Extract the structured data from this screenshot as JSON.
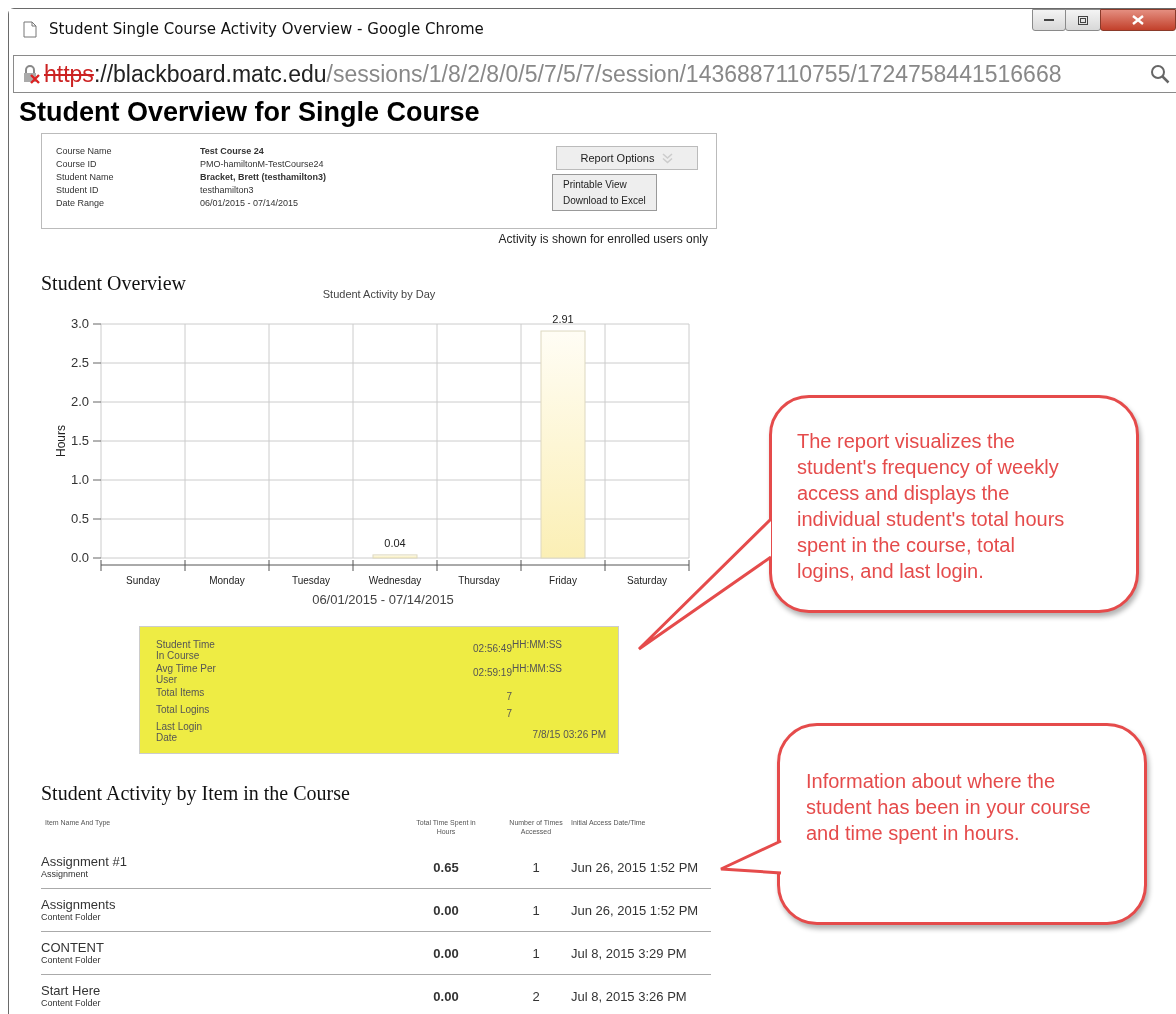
{
  "window": {
    "title": "Student Single Course Activity Overview - Google Chrome"
  },
  "address_bar": {
    "scheme": "https",
    "host": "://blackboard.matc.edu",
    "path": "/sessions/1/8/2/8/0/5/7/5/7/session/1436887110755/1724758441516668",
    "insecure": true
  },
  "page_title": "Student Overview for Single Course",
  "course_info": [
    {
      "label": "Course Name",
      "value": "Test Course 24",
      "bold": true
    },
    {
      "label": "Course ID",
      "value": "PMO-hamiltonM-TestCourse24",
      "bold": false
    },
    {
      "label": "Student Name",
      "value": "Bracket, Brett (testhamilton3)",
      "bold": true
    },
    {
      "label": "Student ID",
      "value": "testhamilton3",
      "bold": false
    },
    {
      "label": "Date Range",
      "value": "06/01/2015 - 07/14/2015",
      "bold": false
    }
  ],
  "report_options": {
    "label": "Report Options",
    "expanded": true,
    "items": [
      "Printable View",
      "Download to Excel"
    ]
  },
  "notice": "Activity is shown for enrolled users only",
  "overview_heading": "Student Overview",
  "chart_data": {
    "type": "bar",
    "title": "Student Activity by Day",
    "xlabel": "06/01/2015 - 07/14/2015",
    "ylabel": "Hours",
    "categories": [
      "Sunday",
      "Monday",
      "Tuesday",
      "Wednesday",
      "Thursday",
      "Friday",
      "Saturday"
    ],
    "values": [
      0,
      0,
      0,
      0.04,
      0,
      2.91,
      0
    ],
    "ylim": [
      0,
      3
    ],
    "yticks": [
      {
        "value": 0,
        "label": "0.0"
      },
      {
        "value": 0.5,
        "label": "0.5"
      },
      {
        "value": 1,
        "label": "1.0"
      },
      {
        "value": 1.5,
        "label": "1.5"
      },
      {
        "value": 2,
        "label": "2.0"
      },
      {
        "value": 2.5,
        "label": "2.5"
      },
      {
        "value": 3,
        "label": "3.0"
      }
    ],
    "grid": true,
    "value_labels": [
      null,
      null,
      null,
      "0.04",
      null,
      "2.91",
      null
    ]
  },
  "summary": [
    {
      "kind": "duration",
      "label": "Student Time In Course",
      "value": "02:56:49",
      "unit": "HH:MM:SS"
    },
    {
      "kind": "duration",
      "label": "Avg Time Per User",
      "value": "02:59:19",
      "unit": "HH:MM:SS"
    },
    {
      "kind": "count",
      "label": "Total Items",
      "value": "7"
    },
    {
      "kind": "count",
      "label": "Total Logins",
      "value": "7"
    },
    {
      "kind": "date",
      "label": "Last Login Date",
      "value": "7/8/15 03:26 PM"
    }
  ],
  "items_heading": "Student Activity by Item in the Course",
  "table": {
    "columns": [
      "Item Name And Type",
      "Total Time Spent in Hours",
      "Number of Times Accessed",
      "Initial Access Date/Time"
    ],
    "rows": [
      {
        "name": "Assignment #1",
        "type": "Assignment",
        "hours": "0.65",
        "times": "1",
        "initial_access": "Jun 26, 2015 1:52 PM"
      },
      {
        "name": "Assignments",
        "type": "Content Folder",
        "hours": "0.00",
        "times": "1",
        "initial_access": "Jun 26, 2015 1:52 PM"
      },
      {
        "name": "CONTENT",
        "type": "Content Folder",
        "hours": "0.00",
        "times": "1",
        "initial_access": "Jul 8, 2015 3:29 PM"
      },
      {
        "name": "Start Here",
        "type": "Content Folder",
        "hours": "0.00",
        "times": "2",
        "initial_access": "Jul 8, 2015 3:26 PM"
      }
    ]
  },
  "callouts": [
    {
      "text": "The report visualizes the student's frequency of weekly access and displays the individual student's total hours spent in the course, total logins, and last login."
    },
    {
      "text": "Information about where the student has been in your course and time spent in hours."
    }
  ]
}
